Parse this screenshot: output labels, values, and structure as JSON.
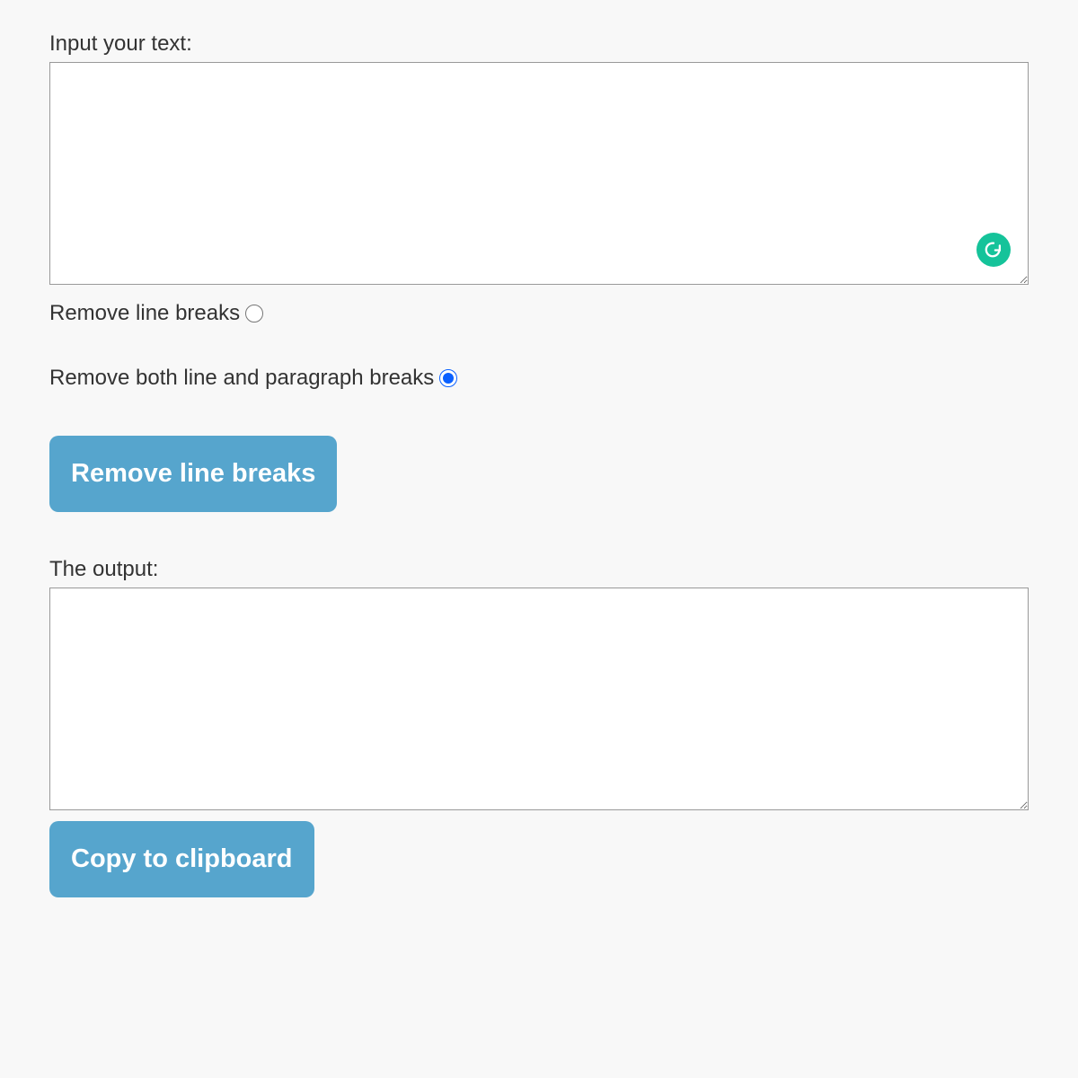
{
  "input": {
    "label": "Input your text:",
    "value": ""
  },
  "options": {
    "removeLineBreaks": {
      "label": "Remove line breaks",
      "checked": false
    },
    "removeBoth": {
      "label": "Remove both line and paragraph breaks",
      "checked": true
    }
  },
  "actionButton": {
    "label": "Remove line breaks"
  },
  "output": {
    "label": "The output:",
    "value": ""
  },
  "copyButton": {
    "label": "Copy to clipboard"
  },
  "icons": {
    "grammarly": "grammarly-icon"
  }
}
